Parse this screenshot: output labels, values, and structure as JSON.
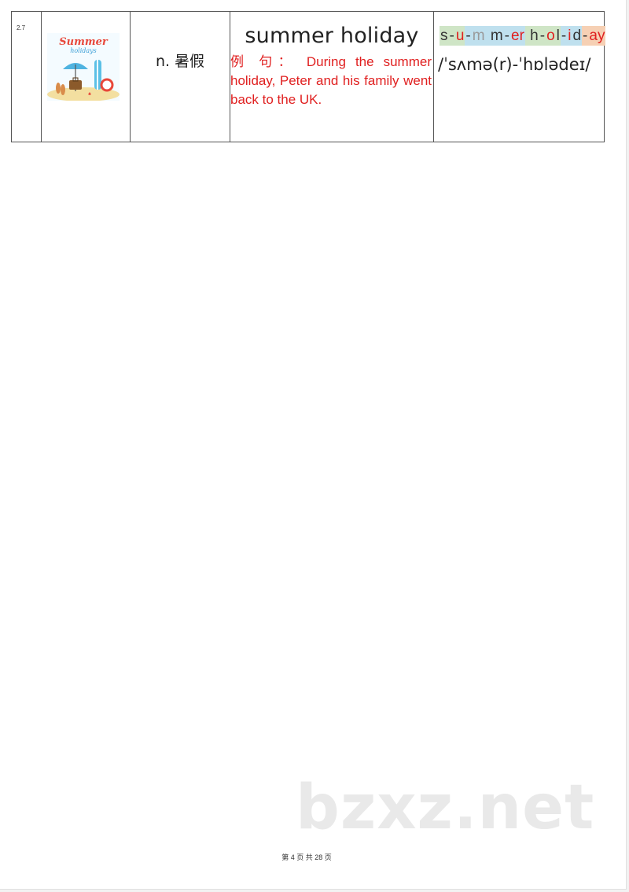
{
  "entry": {
    "number": "2.7",
    "image_title": "Summer",
    "image_subtitle": "holidays",
    "part_of_speech": "n. 暑假",
    "word": "summer holiday",
    "example": "例 句： During the summer holiday, Peter and his family went back to the UK.",
    "ipa": "/ˈsʌmə(r)-ˈhɒlədeɪ/",
    "spelling": [
      {
        "text": "s",
        "bg": "#cfe5c6",
        "color": "#333333"
      },
      {
        "text": "-",
        "bg": "#cfe5c6",
        "color": "#333333"
      },
      {
        "text": "u",
        "bg": "#cfe5c6",
        "color": "#e02020"
      },
      {
        "text": "-",
        "bg": "#bfe0ee",
        "color": "#333333"
      },
      {
        "text": "m",
        "bg": "#bfe0ee",
        "color": "#9a9a9a"
      },
      {
        "text": " m",
        "bg": "#bfe0ee",
        "color": "#333333"
      },
      {
        "text": "-",
        "bg": "#bfe0ee",
        "color": "#333333"
      },
      {
        "text": "er",
        "bg": "#bfe0ee",
        "color": "#e02020"
      },
      {
        "text": " h",
        "bg": "#cfe5c6",
        "color": "#333333"
      },
      {
        "text": "-",
        "bg": "#cfe5c6",
        "color": "#333333"
      },
      {
        "text": "o",
        "bg": "#cfe5c6",
        "color": "#e02020"
      },
      {
        "text": "l",
        "bg": "#cfe5c6",
        "color": "#333333"
      },
      {
        "text": "-",
        "bg": "#bfe0ee",
        "color": "#333333"
      },
      {
        "text": "i",
        "bg": "#bfe0ee",
        "color": "#e02020"
      },
      {
        "text": "d",
        "bg": "#bfe0ee",
        "color": "#333333"
      },
      {
        "text": "-",
        "bg": "#f6d0b4",
        "color": "#333333"
      },
      {
        "text": "ay",
        "bg": "#f6d0b4",
        "color": "#e02020"
      }
    ]
  },
  "watermark": "bzxz.net",
  "footer": "第 4 页 共 28 页"
}
